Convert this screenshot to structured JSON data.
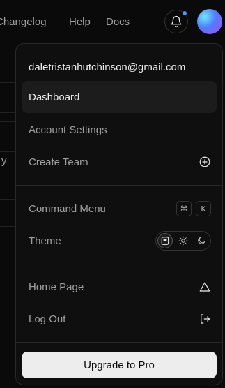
{
  "nav": {
    "links": [
      "Changelog",
      "Help",
      "Docs"
    ],
    "has_notification": true
  },
  "background": {
    "fragment_text": "y"
  },
  "menu": {
    "email": "daletristanhutchinson@gmail.com",
    "items": [
      {
        "label": "Dashboard",
        "active": true
      },
      {
        "label": "Account Settings"
      },
      {
        "label": "Create Team",
        "icon": "plus-circle-icon"
      },
      {
        "label": "Command Menu",
        "shortcut": [
          "⌘",
          "K"
        ]
      },
      {
        "label": "Theme",
        "options": [
          "system-icon",
          "sun-icon",
          "moon-icon"
        ],
        "selected": "system-icon"
      },
      {
        "label": "Home Page",
        "icon": "triangle-icon"
      },
      {
        "label": "Log Out",
        "icon": "logout-icon"
      }
    ],
    "upgrade_label": "Upgrade to Pro"
  },
  "colors": {
    "background": "#0a0a0a",
    "menu_bg": "#0f0f0f",
    "notification_dot": "#3b9eff",
    "upgrade_bg": "#ededed"
  }
}
